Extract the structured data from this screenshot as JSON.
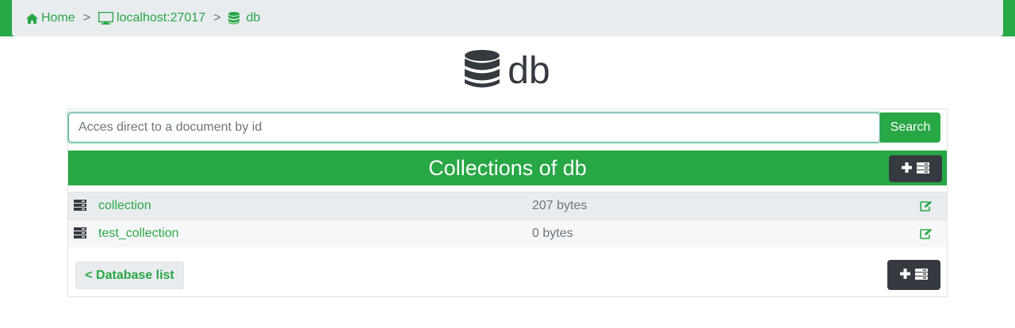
{
  "breadcrumb": {
    "home": "Home",
    "server": "localhost:27017",
    "database": "db",
    "separator": ">"
  },
  "title": "db",
  "search": {
    "placeholder": "Acces direct to a document by id",
    "button_label": "Search"
  },
  "collections": {
    "header": "Collections of db",
    "rows": [
      {
        "name": "collection",
        "size": "207 bytes"
      },
      {
        "name": "test_collection",
        "size": "0 bytes"
      }
    ],
    "back_label": "< Database list"
  },
  "colors": {
    "accent": "#28a745",
    "dark": "#343a40",
    "breadcrumb_bg": "#e9ecef"
  }
}
